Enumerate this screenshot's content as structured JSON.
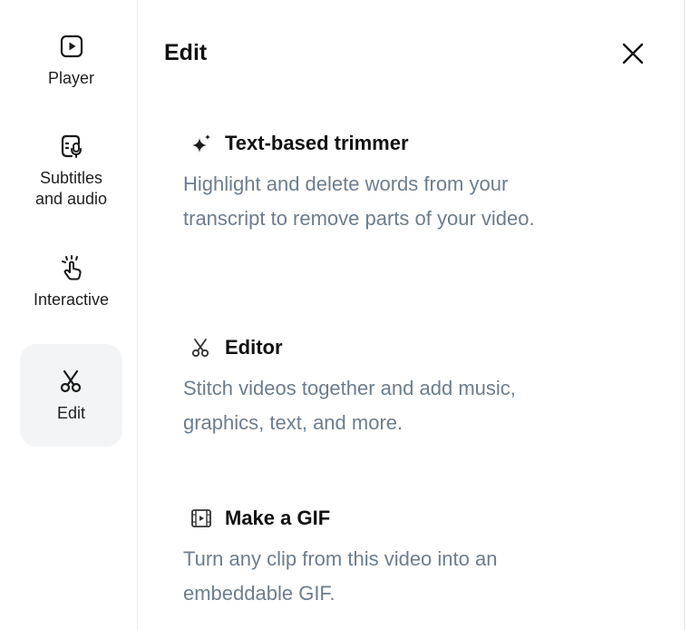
{
  "sidebar": {
    "items": [
      {
        "label": "Player",
        "icon": "play-square-icon"
      },
      {
        "label": "Subtitles and audio",
        "icon": "subtitles-mic-icon"
      },
      {
        "label": "Interactive",
        "icon": "tap-hand-icon"
      },
      {
        "label": "Edit",
        "icon": "scissors-icon",
        "active": true
      }
    ]
  },
  "panel": {
    "title": "Edit",
    "close_icon": "close-icon",
    "features": [
      {
        "icon": "sparkle-icon",
        "title": "Text-based trimmer",
        "description": "Highlight and delete words from your transcript to remove parts of your video."
      },
      {
        "icon": "scissors-icon",
        "title": "Editor",
        "description": "Stitch videos together and add music, graphics, text, and more."
      },
      {
        "icon": "film-frame-icon",
        "title": "Make a GIF",
        "description": "Turn any clip from this video into an embeddable GIF."
      }
    ]
  },
  "colors": {
    "title_text": "#111111",
    "description_text": "#6c7d8e",
    "active_background": "#f2f4f6"
  }
}
